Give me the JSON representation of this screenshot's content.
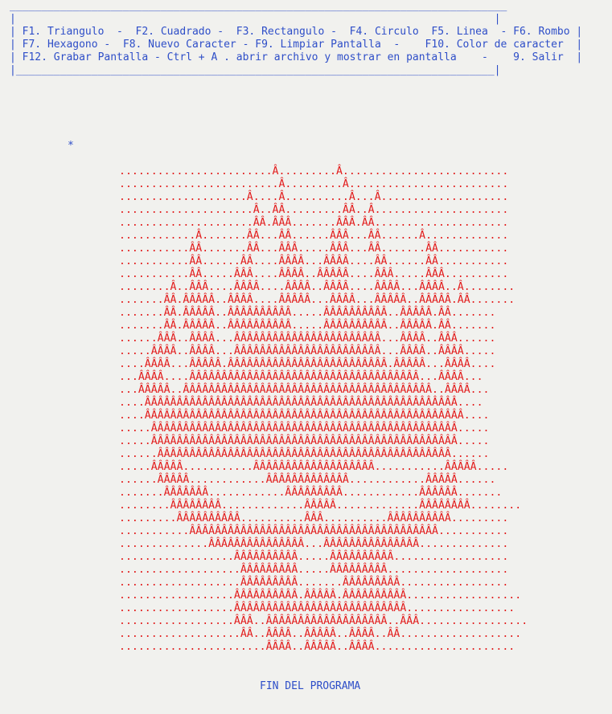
{
  "menu": {
    "top_border": "_______________________________________________________________________________",
    "lines": [
      "|                                                                            |",
      "| F1. Triangulo  -  F2. Cuadrado -  F3. Rectangulo -  F4. Circulo  F5. Linea  - F6. Rombo |",
      "| F7. Hexagono -  F8. Nuevo Caracter - F9. Limpiar Pantalla  -    F10. Color de caracter  |",
      "| F12. Grabar Pantalla - Ctrl + A . abrir archivo y mostrar en pantalla    -    9. Salir  |",
      "|____________________________________________________________________________|"
    ]
  },
  "cursor_marker": "*",
  "art_rows": [
    "........................Â.........Â..........................",
    ".........................Â.........Â.........................",
    "....................Â....Â..........Â...Â....................",
    ".....................Â..ÂÂ.........ÂÂ..Â.....................",
    ".....................ÂÂ.ÂÂÂ.......ÂÂÂ.ÂÂ.....................",
    "............Â.......ÂÂ...ÂÂ......ÂÂÂ...ÂÂ......Â.............",
    "...........ÂÂ.......ÂÂ...ÂÂÂ.....ÂÂÂ...ÂÂ.......ÂÂ...........",
    "...........ÂÂ......ÂÂ....ÂÂÂÂ...ÂÂÂÂ....ÂÂ......ÂÂ...........",
    "...........ÂÂ.....ÂÂÂ....ÂÂÂÂ..ÂÂÂÂÂ....ÂÂÂ.....ÂÂÂ..........",
    "........Â..ÂÂÂ....ÂÂÂÂ....ÂÂÂÂ..ÂÂÂÂ....ÂÂÂÂ...ÂÂÂÂ..Â........",
    ".......ÂÂ.ÂÂÂÂÂ..ÂÂÂÂ....ÂÂÂÂÂ...ÂÂÂÂ...ÂÂÂÂÂ..ÂÂÂÂÂ.ÂÂ.......",
    ".......ÂÂ.ÂÂÂÂÂ..ÂÂÂÂÂÂÂÂÂÂ.....ÂÂÂÂÂÂÂÂÂÂ..ÂÂÂÂÂ.ÂÂ.......",
    ".......ÂÂ.ÂÂÂÂÂ..ÂÂÂÂÂÂÂÂÂÂ.....ÂÂÂÂÂÂÂÂÂÂ..ÂÂÂÂÂ.ÂÂ.......",
    "......ÂÂÂ..ÂÂÂÂ...ÂÂÂÂÂÂÂÂÂÂÂÂÂÂÂÂÂÂÂÂÂÂÂ...ÂÂÂÂ..ÂÂÂ......",
    ".....ÂÂÂÂ..ÂÂÂÂ...ÂÂÂÂÂÂÂÂÂÂÂÂÂÂÂÂÂÂÂÂÂÂÂ...ÂÂÂÂ..ÂÂÂÂ.....",
    "....ÂÂÂÂ...ÂÂÂÂÂ.ÂÂÂÂÂÂÂÂÂÂÂÂÂÂÂÂÂÂÂÂÂÂÂÂÂ.ÂÂÂÂÂ...ÂÂÂÂ....",
    "...ÂÂÂÂ....ÂÂÂÂÂÂÂÂÂÂÂÂÂÂÂÂÂÂÂÂÂÂÂÂÂÂÂÂÂÂÂÂÂÂÂÂ...ÂÂÂÂ...",
    "...ÂÂÂÂÂ..ÂÂÂÂÂÂÂÂÂÂÂÂÂÂÂÂÂÂÂÂÂÂÂÂÂÂÂÂÂÂÂÂÂÂÂÂÂÂÂ..ÂÂÂÂ...",
    "....ÂÂÂÂÂÂÂÂÂÂÂÂÂÂÂÂÂÂÂÂÂÂÂÂÂÂÂÂÂÂÂÂÂÂÂÂÂÂÂÂÂÂÂÂÂÂÂÂÂ....",
    "....ÂÂÂÂÂÂÂÂÂÂÂÂÂÂÂÂÂÂÂÂÂÂÂÂÂÂÂÂÂÂÂÂÂÂÂÂÂÂÂÂÂÂÂÂÂÂÂÂÂÂ....",
    ".....ÂÂÂÂÂÂÂÂÂÂÂÂÂÂÂÂÂÂÂÂÂÂÂÂÂÂÂÂÂÂÂÂÂÂÂÂÂÂÂÂÂÂÂÂÂÂÂÂ.....",
    ".....ÂÂÂÂÂÂÂÂÂÂÂÂÂÂÂÂÂÂÂÂÂÂÂÂÂÂÂÂÂÂÂÂÂÂÂÂÂÂÂÂÂÂÂÂÂÂÂÂ.....",
    "......ÂÂÂÂÂÂÂÂÂÂÂÂÂÂÂÂÂÂÂÂÂÂÂÂÂÂÂÂÂÂÂÂÂÂÂÂÂÂÂÂÂÂÂÂÂÂ......",
    ".....ÂÂÂÂÂ...........ÂÂÂÂÂÂÂÂÂÂÂÂÂÂÂÂÂÂÂ...........ÂÂÂÂÂ.....",
    "......ÂÂÂÂÂ............ÂÂÂÂÂÂÂÂÂÂÂÂÂ............ÂÂÂÂÂ......",
    ".......ÂÂÂÂÂÂÂ............ÂÂÂÂÂÂÂÂÂ............ÂÂÂÂÂÂ.......",
    "........ÂÂÂÂÂÂÂÂ.............ÂÂÂÂÂ.............ÂÂÂÂÂÂÂÂ........",
    ".........ÂÂÂÂÂÂÂÂÂÂ..........ÂÂÂ..........ÂÂÂÂÂÂÂÂÂÂ.........",
    "...........ÂÂÂÂÂÂÂÂÂÂÂÂÂÂÂÂÂÂÂÂÂÂÂÂÂÂÂÂÂÂÂÂÂÂÂÂÂÂÂ...........",
    "..............ÂÂÂÂÂÂÂÂÂÂÂÂÂÂÂ...ÂÂÂÂÂÂÂÂÂÂÂÂÂÂÂ..............",
    "..................ÂÂÂÂÂÂÂÂÂÂ.....ÂÂÂÂÂÂÂÂÂÂ..................",
    "...................ÂÂÂÂÂÂÂÂÂ.....ÂÂÂÂÂÂÂÂÂ...................",
    "...................ÂÂÂÂÂÂÂÂÂ.......ÂÂÂÂÂÂÂÂÂ.................",
    "..................ÂÂÂÂÂÂÂÂÂÂ.ÂÂÂÂÂ.ÂÂÂÂÂÂÂÂÂÂ..................",
    "..................ÂÂÂÂÂÂÂÂÂÂÂÂÂÂÂÂÂÂÂÂÂÂÂÂÂÂÂ.................",
    "..................ÂÂÂ..ÂÂÂÂÂÂÂÂÂÂÂÂÂÂÂÂÂÂÂ..ÂÂÂ.................",
    "...................ÂÂ..ÂÂÂÂ..ÂÂÂÂÂ..ÂÂÂÂ..ÂÂ...................",
    ".......................ÂÂÂÂ..ÂÂÂÂÂ..ÂÂÂÂ......................"
  ],
  "footer_message": "FIN DEL PROGRAMA",
  "colors": {
    "background": "#f1f1ee",
    "menu_text": "#2e4ec8",
    "art_text": "#e21b1b"
  }
}
